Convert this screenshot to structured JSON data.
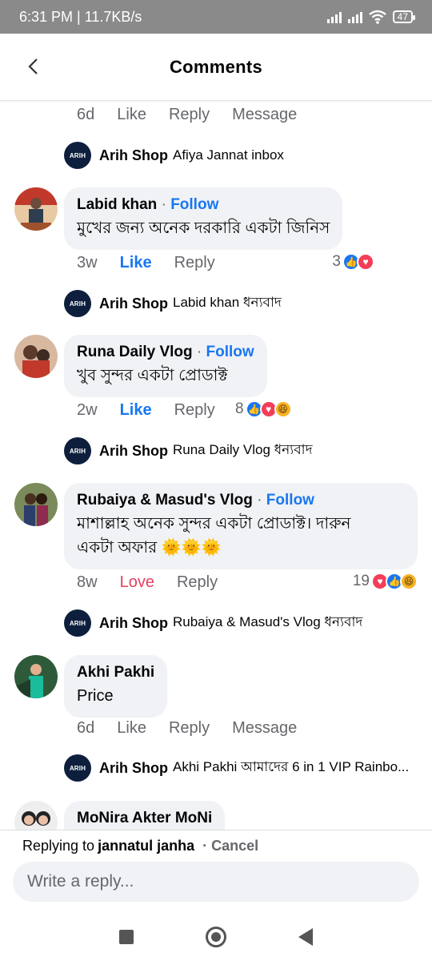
{
  "status": {
    "time": "6:31 PM | 11.7KB/s",
    "battery": "47"
  },
  "header": {
    "title": "Comments"
  },
  "top_actions": {
    "age": "6d",
    "like": "Like",
    "reply": "Reply",
    "message": "Message"
  },
  "threads": [
    {
      "shop_reply": {
        "name": "Arih Shop",
        "text": "Afiya Jannat inbox"
      }
    },
    {
      "author": "Labid khan",
      "follow": "Follow",
      "text": "মুখের জন্য অনেক দরকারি একটা জিনিস",
      "age": "3w",
      "like": "Like",
      "reply": "Reply",
      "reaction_count": "3",
      "shop_reply": {
        "name": "Arih Shop",
        "text": "Labid khan ধন্যবাদ"
      }
    },
    {
      "author": "Runa Daily Vlog",
      "follow": "Follow",
      "text": "খুব সুন্দর একটা প্রোডাক্ট",
      "age": "2w",
      "like": "Like",
      "reply": "Reply",
      "reaction_count": "8",
      "shop_reply": {
        "name": "Arih Shop",
        "text": "Runa Daily Vlog ধন্যবাদ"
      }
    },
    {
      "author": "Rubaiya & Masud's Vlog",
      "follow": "Follow",
      "text_line1": "মাশাল্লাহ অনেক সুন্দর একটা প্রোডাক্ট। দারুন",
      "text_line2": "একটা অফার 🌞🌞🌞",
      "age": "8w",
      "like": "Love",
      "reply": "Reply",
      "reaction_count": "19",
      "shop_reply": {
        "name": "Arih Shop",
        "text": "Rubaiya & Masud's Vlog ধন্যবাদ"
      }
    },
    {
      "author": "Akhi Pakhi",
      "text": "Price",
      "age": "6d",
      "like": "Like",
      "reply": "Reply",
      "message": "Message",
      "shop_reply": {
        "name": "Arih Shop",
        "text": "Akhi Pakhi আমাদের 6 in 1 VIP Rainbo..."
      }
    },
    {
      "author": "MoNira Akter MoNi"
    }
  ],
  "shop_logo_text": "ARIH",
  "replying": {
    "prefix": "Replying to",
    "name": "jannatul janha",
    "cancel": "· Cancel"
  },
  "input": {
    "placeholder": "Write a reply..."
  },
  "colors": {
    "accent": "#1877f2",
    "love": "#e4405f",
    "bubble": "#f0f2f5"
  }
}
